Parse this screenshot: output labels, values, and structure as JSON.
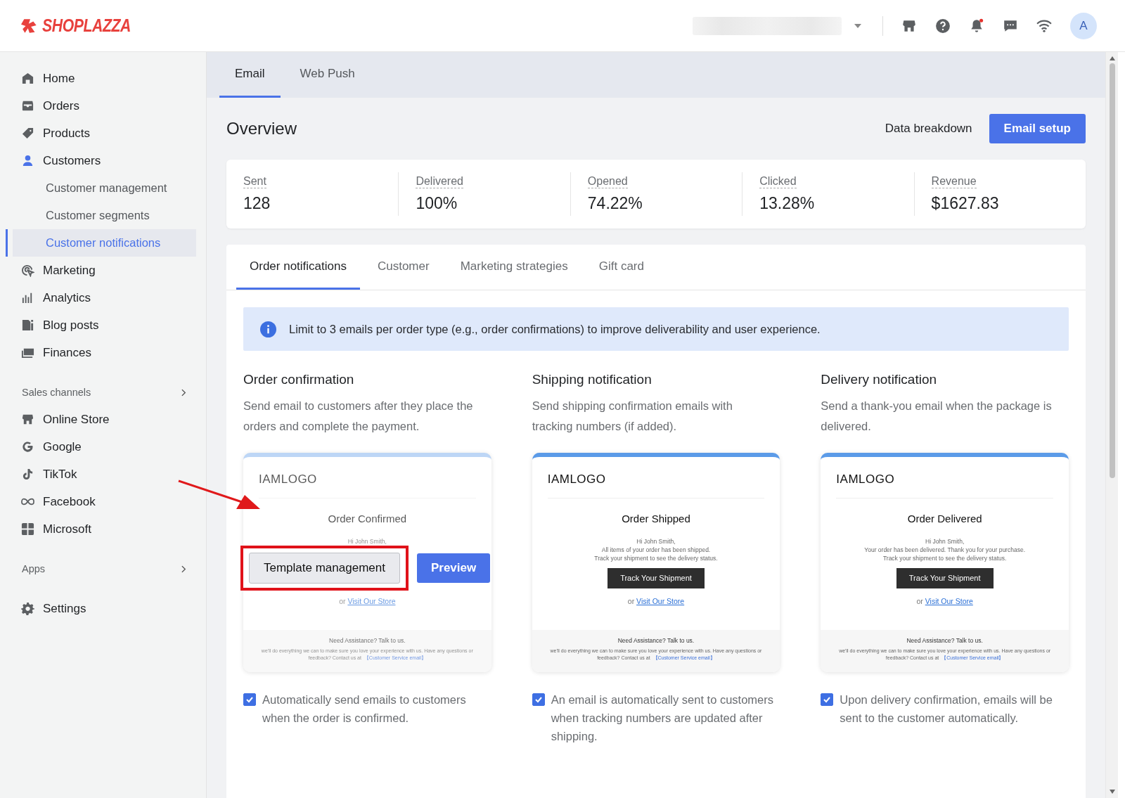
{
  "brand": {
    "name": "SHOPLAZZA"
  },
  "topbar": {
    "avatar": "A",
    "has_unread": true
  },
  "sidebar": {
    "sections": [
      {
        "items": [
          {
            "label": "Home",
            "selected": false
          },
          {
            "label": "Orders",
            "selected": false
          },
          {
            "label": "Products",
            "selected": false
          },
          {
            "label": "Customers",
            "selected": false,
            "expanded": true,
            "children": [
              {
                "label": "Customer management",
                "selected": false
              },
              {
                "label": "Customer segments",
                "selected": false
              },
              {
                "label": "Customer notifications",
                "selected": true
              }
            ]
          },
          {
            "label": "Marketing",
            "selected": false
          },
          {
            "label": "Analytics",
            "selected": false
          },
          {
            "label": "Blog posts",
            "selected": false
          },
          {
            "label": "Finances",
            "selected": false
          }
        ]
      },
      {
        "heading": "Sales channels",
        "items": [
          {
            "label": "Online Store",
            "selected": false
          },
          {
            "label": "Google",
            "selected": false
          },
          {
            "label": "TikTok",
            "selected": false
          },
          {
            "label": "Facebook",
            "selected": false
          },
          {
            "label": "Microsoft",
            "selected": false
          }
        ]
      },
      {
        "heading": "Apps"
      },
      {
        "items": [
          {
            "label": "Settings",
            "selected": false
          }
        ]
      }
    ]
  },
  "page_tabs": [
    {
      "label": "Email",
      "selected": true
    },
    {
      "label": "Web Push",
      "selected": false
    }
  ],
  "overview": {
    "title": "Overview",
    "link": "Data breakdown",
    "button": "Email setup",
    "stats": [
      {
        "label": "Sent",
        "value": "128"
      },
      {
        "label": "Delivered",
        "value": "100%"
      },
      {
        "label": "Opened",
        "value": "74.22%"
      },
      {
        "label": "Clicked",
        "value": "13.28%"
      },
      {
        "label": "Revenue",
        "value": "$1627.83"
      }
    ]
  },
  "notification_tabs": [
    {
      "label": "Order notifications",
      "selected": true
    },
    {
      "label": "Customer",
      "selected": false
    },
    {
      "label": "Marketing strategies",
      "selected": false
    },
    {
      "label": "Gift card",
      "selected": false
    }
  ],
  "info_banner": "Limit to 3 emails per order type (e.g., order confirmations) to improve deliverability and user experience.",
  "templates": [
    {
      "title": "Order confirmation",
      "description": "Send email to customers after they place the orders and complete the payment.",
      "hovered": true,
      "preview": {
        "logo": "IAMLOGO",
        "heading": "Order Confirmed",
        "lines": [
          "Hi John Smith,"
        ],
        "link_prefix": "or",
        "link": "Visit Our Store",
        "footer_title": "Need Assistance? Talk to us.",
        "footer_text": "we'll do everything we can to make sure you love your experience with us. Have any questions or feedback? Contact us at",
        "footer_link": "【Customer Service email】"
      },
      "actions": [
        "Template management",
        "Preview"
      ],
      "auto_send": {
        "checked": true,
        "text": "Automatically send emails to customers when the order is confirmed."
      }
    },
    {
      "title": "Shipping notification",
      "description": "Send shipping confirmation emails with tracking numbers (if added).",
      "hovered": false,
      "preview": {
        "logo": "IAMLOGO",
        "heading": "Order Shipped",
        "lines": [
          "Hi John Smith,",
          "All items of your order has been shipped.",
          "Track your shipment to see the delivery status."
        ],
        "button": "Track Your Shipment",
        "link_prefix": "or",
        "link": "Visit Our Store",
        "footer_title": "Need Assistance? Talk to us.",
        "footer_text": "we'll do everything we can to make sure you love your experience with us. Have any questions or feedback? Contact us at",
        "footer_link": "【Customer Service email】"
      },
      "auto_send": {
        "checked": true,
        "text": "An email is automatically sent to customers when tracking numbers are updated after shipping."
      }
    },
    {
      "title": "Delivery notification",
      "description": "Send a thank-you email when the package is delivered.",
      "hovered": false,
      "preview": {
        "logo": "IAMLOGO",
        "heading": "Order Delivered",
        "lines": [
          "Hi John Smith,",
          "Your order has been delivered. Thank you for your purchase.",
          "Track your shipment to see the delivery status."
        ],
        "button": "Track Your Shipment",
        "link_prefix": "or",
        "link": "Visit Our Store",
        "footer_title": "Need Assistance? Talk to us.",
        "footer_text": "we'll do everything we can to make sure you love your experience with us. Have any questions or feedback? Contact us at",
        "footer_link": "【Customer Service email】"
      },
      "auto_send": {
        "checked": true,
        "text": "Upon delivery confirmation, emails will be sent to the customer automatically."
      }
    }
  ]
}
